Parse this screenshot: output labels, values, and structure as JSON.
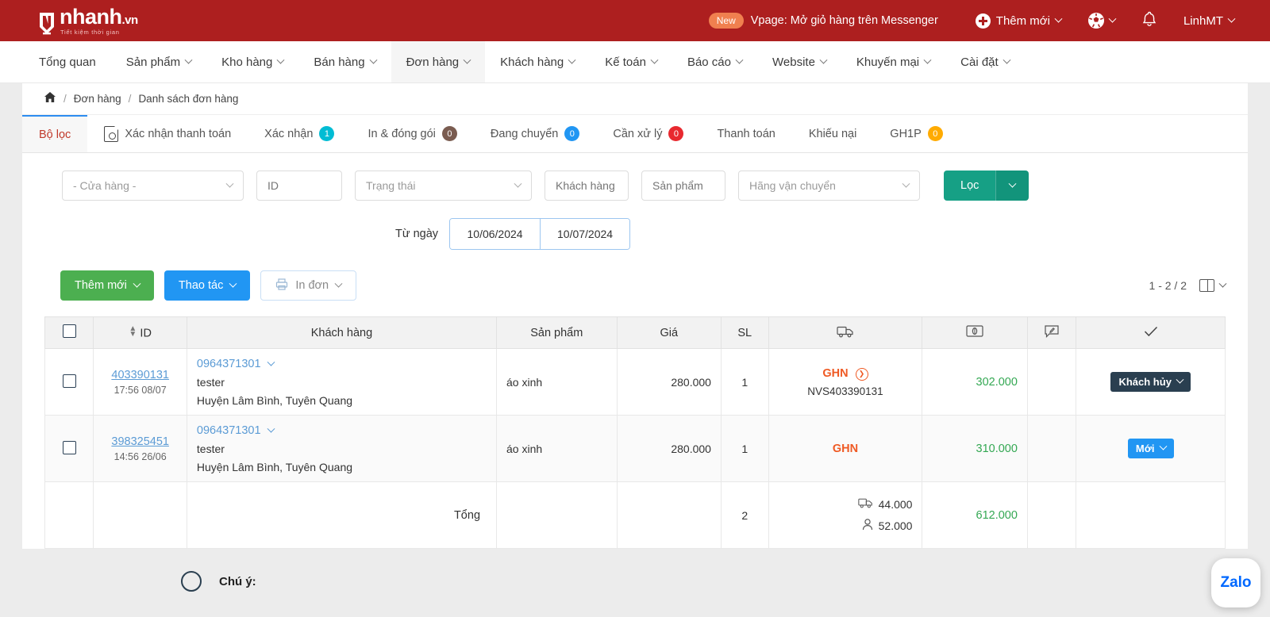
{
  "topbar": {
    "logo_word": "nhanh",
    "logo_tld": ".vn",
    "logo_tagline": "Tiết kiệm thời gian",
    "promo_badge": "New",
    "promo_text": "Vpage: Mở giỏ hàng trên Messenger",
    "add_new": "Thêm mới",
    "user": "LinhMT",
    "bell_icon": "bell-icon",
    "soccer_icon": "soccer-ball-icon",
    "plus_icon": "plus-circle-icon"
  },
  "nav": {
    "items": [
      {
        "label": "Tổng quan",
        "caret": false,
        "active": false
      },
      {
        "label": "Sản phẩm",
        "caret": true,
        "active": false
      },
      {
        "label": "Kho hàng",
        "caret": true,
        "active": false
      },
      {
        "label": "Bán hàng",
        "caret": true,
        "active": false
      },
      {
        "label": "Đơn hàng",
        "caret": true,
        "active": true
      },
      {
        "label": "Khách hàng",
        "caret": true,
        "active": false
      },
      {
        "label": "Kế toán",
        "caret": true,
        "active": false
      },
      {
        "label": "Báo cáo",
        "caret": true,
        "active": false
      },
      {
        "label": "Website",
        "caret": true,
        "active": false
      },
      {
        "label": "Khuyến mại",
        "caret": true,
        "active": false
      },
      {
        "label": "Cài đặt",
        "caret": true,
        "active": false
      }
    ]
  },
  "breadcrumb": {
    "home_icon": "home-icon",
    "sep": "/",
    "level1": "Đơn hàng",
    "level2": "Danh sách đơn hàng"
  },
  "tabs": {
    "filter_label": "Bộ lọc",
    "items": [
      {
        "label": "Xác nhận thanh toán",
        "count": null,
        "color": ""
      },
      {
        "label": "Xác nhận",
        "count": "1",
        "color": "#00bcd4"
      },
      {
        "label": "In & đóng gói",
        "count": "0",
        "color": "#7a5c50"
      },
      {
        "label": "Đang chuyển",
        "count": "0",
        "color": "#2196f3"
      },
      {
        "label": "Cần xử lý",
        "count": "0",
        "color": "#e8292f"
      },
      {
        "label": "Thanh toán",
        "count": null,
        "color": ""
      },
      {
        "label": "Khiếu nại",
        "count": null,
        "color": ""
      },
      {
        "label": "GH1P",
        "count": "0",
        "color": "#ffab00"
      }
    ]
  },
  "filters": {
    "store_placeholder": "- Cửa hàng -",
    "id_placeholder": "ID",
    "status_placeholder": "Trạng thái",
    "customer_placeholder": "Khách hàng",
    "product_placeholder": "Sản phẩm",
    "carrier_placeholder": "Hãng vận chuyển",
    "filter_button": "Lọc",
    "date_label": "Từ ngày",
    "date_from": "10/06/2024",
    "date_to": "10/07/2024"
  },
  "actions": {
    "add_new": "Thêm mới",
    "operations": "Thao tác",
    "print": "In đơn",
    "printer_icon": "printer-icon",
    "pagination": "1 - 2 / 2",
    "column_icon": "columns-icon"
  },
  "table": {
    "headers": {
      "id": "ID",
      "customer": "Khách hàng",
      "product": "Sản phẩm",
      "price": "Giá",
      "qty": "SL",
      "shipping_icon": "truck-icon",
      "money_icon": "cash-icon",
      "note_icon": "note-pencil-icon",
      "status_icon": "check-icon",
      "sort_icon": "sort-icon",
      "select_all_icon": "checkbox-icon"
    },
    "rows": [
      {
        "id": "403390131",
        "time": "17:56 08/07",
        "phone": "0964371301",
        "name": "tester",
        "address": "Huyện Lâm Bình, Tuyên Quang",
        "product": "áo xinh",
        "price": "280.000",
        "qty": "1",
        "carrier": "GHN",
        "carrier_has_link": true,
        "tracking": "NVS403390131",
        "total": "302.000",
        "status": "Khách hủy",
        "status_style": "dark"
      },
      {
        "id": "398325451",
        "time": "14:56 26/06",
        "phone": "0964371301",
        "name": "tester",
        "address": "Huyện Lâm Bình, Tuyên Quang",
        "product": "áo xinh",
        "price": "280.000",
        "qty": "1",
        "carrier": "GHN",
        "carrier_has_link": false,
        "tracking": "",
        "total": "310.000",
        "status": "Mới",
        "status_style": "blue"
      }
    ],
    "footer": {
      "label": "Tổng",
      "qty": "2",
      "ship_fee": "44.000",
      "cod_fee": "52.000",
      "total": "612.000",
      "ship_icon": "truck-icon",
      "person_icon": "person-icon"
    }
  },
  "note": {
    "icon": "info-circle-icon",
    "title": "Chú ý:"
  },
  "widget": {
    "zalo_label": "Zalo"
  },
  "colors": {
    "brand_red": "#ad1f1f",
    "green_button": "#4caf50",
    "blue_button": "#2196f3",
    "teal_filter": "#16a085",
    "money_green": "#34a853",
    "carrier_orange": "#ef5a24",
    "link_blue": "#5b9bd5"
  }
}
